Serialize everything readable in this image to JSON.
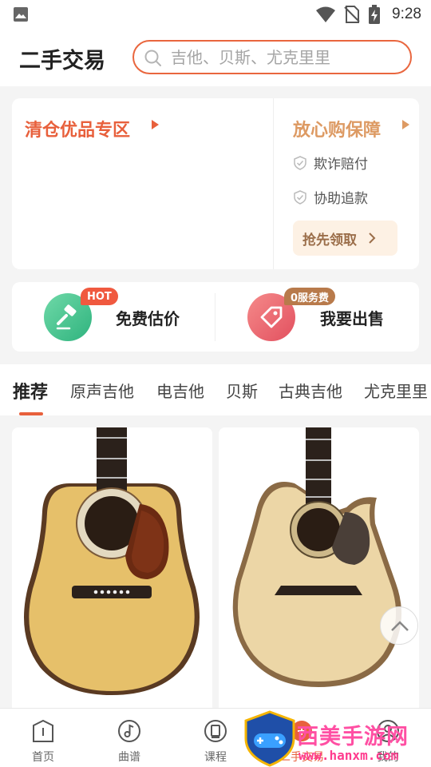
{
  "status_bar": {
    "time": "9:28",
    "icons": [
      "gallery-icon",
      "wifi-icon",
      "no-sim-icon",
      "battery-charging-icon"
    ]
  },
  "header": {
    "title": "二手交易",
    "search_placeholder": "吉他、贝斯、尤克里里"
  },
  "promo": {
    "clearance_title": "清仓优品专区",
    "assurance_title": "放心购保障",
    "assurance_items": [
      "欺诈赔付",
      "协助追款"
    ],
    "claim_button": "抢先领取"
  },
  "actions": {
    "estimate": {
      "badge": "HOT",
      "label": "免费估价"
    },
    "sell": {
      "badge": "0服务费",
      "label": "我要出售"
    }
  },
  "tabs": [
    "推荐",
    "原声吉他",
    "电吉他",
    "贝斯",
    "古典吉他",
    "尤克里里"
  ],
  "active_tab_index": 0,
  "products": [
    {
      "image": "dreadnought-acoustic-guitar"
    },
    {
      "image": "cutaway-acoustic-guitar"
    }
  ],
  "bottom_nav": [
    "首页",
    "曲谱",
    "课程",
    "二手交易",
    "我的"
  ],
  "watermark": {
    "text": "西美手游网",
    "url": "www.hanxm.com"
  },
  "colors": {
    "accent": "#e8603c",
    "gold": "#dd9a63",
    "green": "#2fb37e",
    "red": "#e2505f"
  }
}
